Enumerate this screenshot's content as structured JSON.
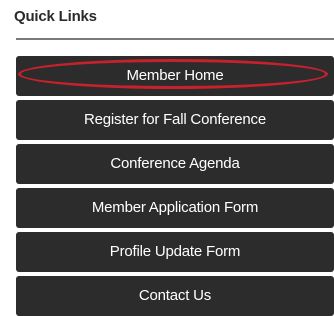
{
  "quick_links": {
    "heading": "Quick Links",
    "items": [
      {
        "label": "Member Home",
        "highlighted": true
      },
      {
        "label": "Register for Fall Conference"
      },
      {
        "label": "Conference Agenda"
      },
      {
        "label": "Member Application Form"
      },
      {
        "label": "Profile Update Form"
      },
      {
        "label": "Contact Us"
      }
    ]
  },
  "colors": {
    "button_bg": "#2c2c2c",
    "button_text": "#ffffff",
    "highlight_ring": "#c7212d",
    "heading_text": "#2b2b2b",
    "divider": "#7a7a7a"
  }
}
